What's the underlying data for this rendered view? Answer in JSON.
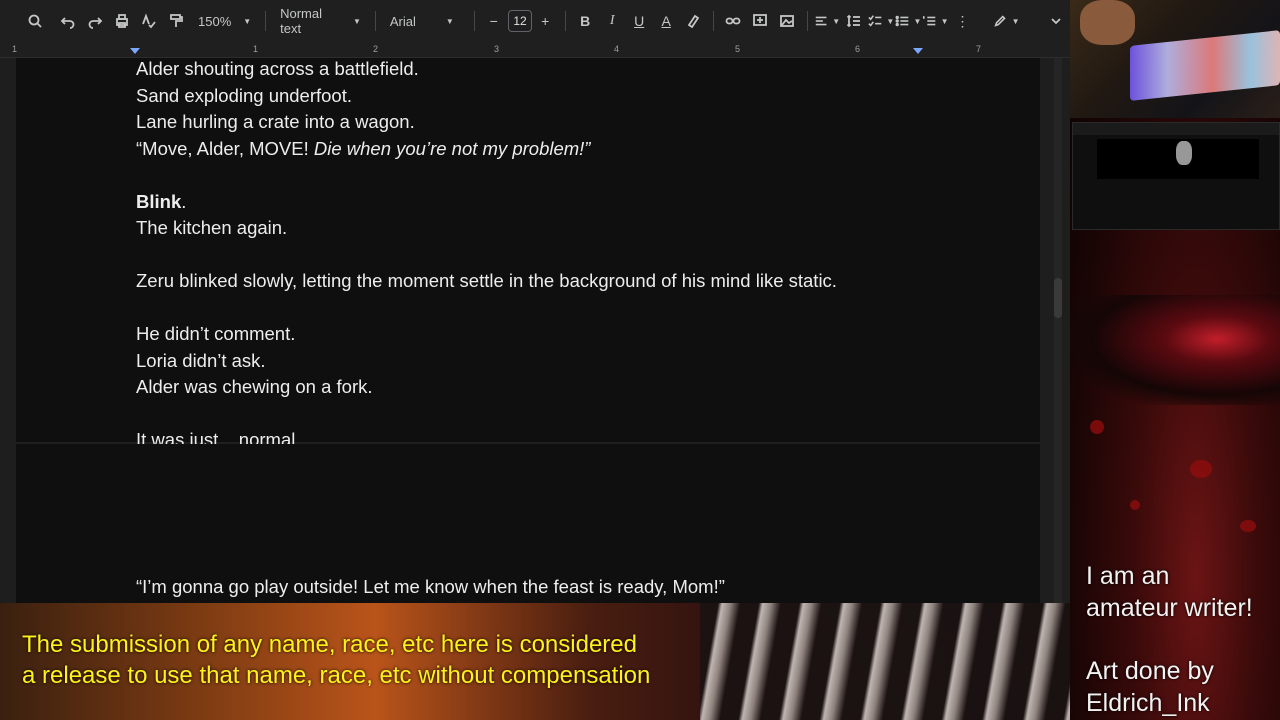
{
  "toolbar": {
    "zoom": "150%",
    "style": "Normal text",
    "font": "Arial",
    "font_size": "12"
  },
  "ruler": {
    "ticks": [
      "1",
      "1",
      "2",
      "3",
      "4",
      "5",
      "6",
      "7"
    ]
  },
  "document": {
    "page1_lines": [
      {
        "text": "Alder shouting across a battlefield."
      },
      {
        "text": "Sand exploding underfoot."
      },
      {
        "text": "Lane hurling a crate into a wagon."
      },
      {
        "text_normal": "“Move, Alder, MOVE! ",
        "text_italic": "Die when you’re not my problem!”"
      },
      {
        "blank": true
      },
      {
        "text_bold": "Blink",
        "text_after": "."
      },
      {
        "text": "The kitchen again."
      },
      {
        "blank": true
      },
      {
        "text": "Zeru blinked slowly, letting the moment settle in the background of his mind like static."
      },
      {
        "blank": true
      },
      {
        "text": "He didn’t comment."
      },
      {
        "text": "Loria didn’t ask."
      },
      {
        "text": "Alder was chewing on a fork."
      },
      {
        "blank": true
      },
      {
        "text_before": "It was just",
        "text_dotted": "...",
        "text_after": " normal."
      }
    ],
    "page2_first_line": "“I’m gonna go play outside! Let me know when the feast is ready, Mom!”"
  },
  "overlay": {
    "notice_line1": "The submission of any name, race, etc here is considered",
    "notice_line2": "a release to use that name, race, etc without compensation",
    "promo_line1": "I am an",
    "promo_line2": "amateur writer!",
    "promo_line3": "Art done by",
    "promo_line4": "Eldrich_Ink"
  },
  "colors": {
    "notice": "#fff21a",
    "page_bg": "#0f0f0f",
    "text": "#ededed"
  }
}
